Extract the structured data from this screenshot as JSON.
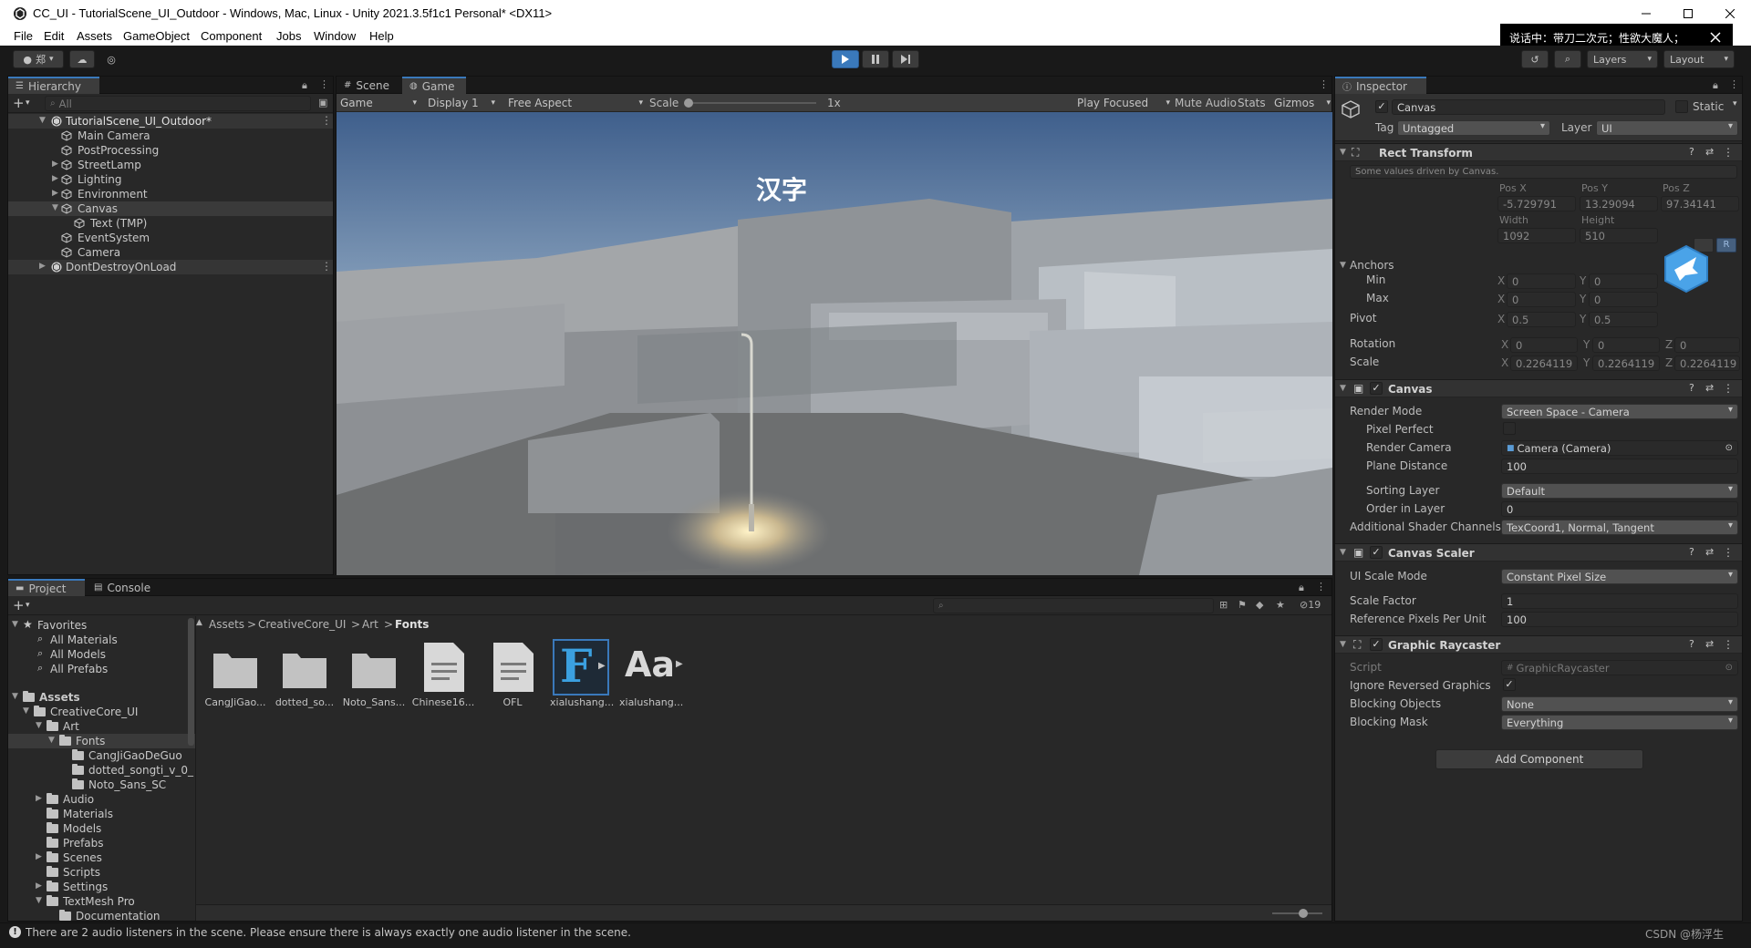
{
  "window": {
    "title": "CC_UI - TutorialScene_UI_Outdoor - Windows, Mac, Linux - Unity 2021.3.5f1c1 Personal* <DX11>"
  },
  "menu": [
    "File",
    "Edit",
    "Assets",
    "GameObject",
    "Component",
    "Jobs",
    "Window",
    "Help"
  ],
  "notification": {
    "text": "说话中：带刀二次元；性欲大魔人；"
  },
  "toolbar": {
    "account_label": "郑",
    "layers_label": "Layers",
    "layout_label": "Layout"
  },
  "hierarchy": {
    "tab": "Hierarchy",
    "search_placeholder": "All",
    "items": [
      {
        "label": "TutorialScene_UI_Outdoor*"
      },
      {
        "label": "Main Camera"
      },
      {
        "label": "PostProcessing"
      },
      {
        "label": "StreetLamp"
      },
      {
        "label": "Lighting"
      },
      {
        "label": "Environment"
      },
      {
        "label": "Canvas"
      },
      {
        "label": "Text (TMP)"
      },
      {
        "label": "EventSystem"
      },
      {
        "label": "Camera"
      },
      {
        "label": "DontDestroyOnLoad"
      }
    ]
  },
  "game_view": {
    "tabs": [
      "Scene",
      "Game"
    ],
    "mode": "Game",
    "display": "Display 1",
    "aspect": "Free Aspect",
    "scale_label": "Scale",
    "scale_value": "1x",
    "play_focused": "Play Focused",
    "mute_audio": "Mute Audio",
    "stats": "Stats",
    "gizmos": "Gizmos",
    "scene_text": "汉字"
  },
  "inspector": {
    "tab": "Inspector",
    "object_name": "Canvas",
    "static_label": "Static",
    "tag_label": "Tag",
    "tag_value": "Untagged",
    "layer_label": "Layer",
    "layer_value": "UI",
    "rect_transform": {
      "title": "Rect Transform",
      "note": "Some values driven by Canvas.",
      "pos_x_label": "Pos X",
      "pos_y_label": "Pos Y",
      "pos_z_label": "Pos Z",
      "pos_x": "-5.729791",
      "pos_y": "13.29094",
      "pos_z": "97.34141",
      "width_label": "Width",
      "height_label": "Height",
      "width": "1092",
      "height": "510",
      "anchors_label": "Anchors",
      "min_label": "Min",
      "max_label": "Max",
      "min_x": "0",
      "min_y": "0",
      "max_x": "0",
      "max_y": "0",
      "pivot_label": "Pivot",
      "pivot_x": "0.5",
      "pivot_y": "0.5",
      "rotation_label": "Rotation",
      "rot_x": "0",
      "rot_y": "0",
      "rot_z": "0",
      "scale_label": "Scale",
      "scale_x": "0.2264119",
      "scale_y": "0.2264119",
      "scale_z": "0.2264119",
      "axis_x": "X",
      "axis_y": "Y",
      "axis_z": "Z",
      "r_button": "R"
    },
    "canvas": {
      "title": "Canvas",
      "render_mode_label": "Render Mode",
      "render_mode": "Screen Space - Camera",
      "pixel_perfect_label": "Pixel Perfect",
      "render_camera_label": "Render Camera",
      "render_camera": "Camera (Camera)",
      "plane_distance_label": "Plane Distance",
      "plane_distance": "100",
      "sorting_layer_label": "Sorting Layer",
      "sorting_layer": "Default",
      "order_label": "Order in Layer",
      "order": "0",
      "shader_channels_label": "Additional Shader Channels",
      "shader_channels": "TexCoord1, Normal, Tangent"
    },
    "canvas_scaler": {
      "title": "Canvas Scaler",
      "mode_label": "UI Scale Mode",
      "mode": "Constant Pixel Size",
      "factor_label": "Scale Factor",
      "factor": "1",
      "ref_ppu_label": "Reference Pixels Per Unit",
      "ref_ppu": "100"
    },
    "graphic_raycaster": {
      "title": "Graphic Raycaster",
      "script_label": "Script",
      "script": "GraphicRaycaster",
      "ignore_label": "Ignore Reversed Graphics",
      "blocking_objects_label": "Blocking Objects",
      "blocking_objects": "None",
      "blocking_mask_label": "Blocking Mask",
      "blocking_mask": "Everything"
    },
    "add_component": "Add Component"
  },
  "project": {
    "tabs": [
      "Project",
      "Console"
    ],
    "hidden_count": "19",
    "breadcrumb": [
      "Assets",
      "CreativeCore_UI",
      "Art",
      "Fonts"
    ],
    "favorites_label": "Favorites",
    "favorites": [
      "All Materials",
      "All Models",
      "All Prefabs"
    ],
    "tree": [
      {
        "label": "Assets"
      },
      {
        "label": "CreativeCore_UI"
      },
      {
        "label": "Art"
      },
      {
        "label": "Fonts"
      },
      {
        "label": "CangJiGaoDeGuo"
      },
      {
        "label": "dotted_songti_v_0_"
      },
      {
        "label": "Noto_Sans_SC"
      },
      {
        "label": "Audio"
      },
      {
        "label": "Materials"
      },
      {
        "label": "Models"
      },
      {
        "label": "Prefabs"
      },
      {
        "label": "Scenes"
      },
      {
        "label": "Scripts"
      },
      {
        "label": "Settings"
      },
      {
        "label": "TextMesh Pro"
      },
      {
        "label": "Documentation"
      }
    ],
    "assets": [
      {
        "label": "CangJiGao...",
        "kind": "folder"
      },
      {
        "label": "dotted_so...",
        "kind": "folder"
      },
      {
        "label": "Noto_Sans...",
        "kind": "folder"
      },
      {
        "label": "Chinese16...",
        "kind": "text-file"
      },
      {
        "label": "OFL",
        "kind": "text-file"
      },
      {
        "label": "xialushang...",
        "kind": "font-asset",
        "glyph": "F"
      },
      {
        "label": "xialushang...",
        "kind": "font-file",
        "glyph": "Aa"
      }
    ]
  },
  "status": {
    "message": "There are 2 audio listeners in the scene. Please ensure there is always exactly one audio listener in the scene.",
    "watermark": "CSDN @杨浮生"
  },
  "colors": {
    "accent": "#3a79bb",
    "panel": "#282828",
    "toolbar": "#3c3c3c",
    "play_active": "#3a79bb"
  }
}
